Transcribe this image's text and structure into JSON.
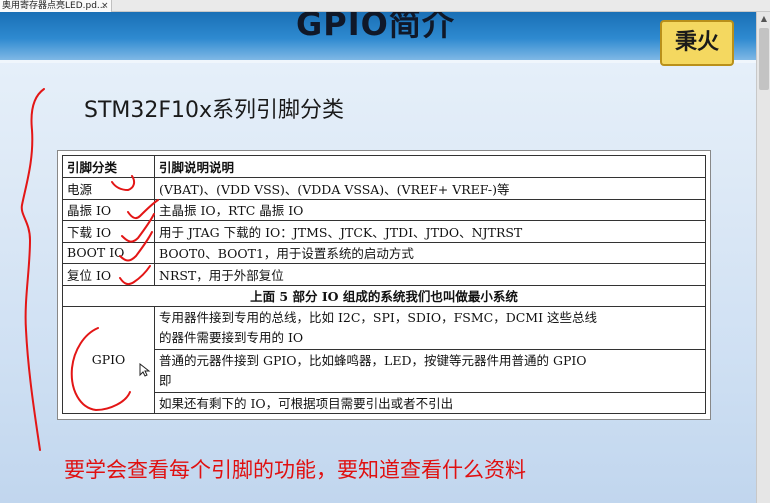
{
  "tab": {
    "title": "奥用寄存器点亮LED.pd...",
    "close": "×"
  },
  "slide": {
    "title": "GPIO简介",
    "logo": "秉火",
    "subtitle": "STM32F10x系列引脚分类",
    "bottom_note": "要学会查看每个引脚的功能，要知道查看什么资料"
  },
  "table": {
    "headers": [
      "引脚分类",
      "引脚说明说明"
    ],
    "rows": [
      [
        "电源",
        "(VBAT)、(VDD VSS)、(VDDA VSSA)、(VREF+ VREF-)等"
      ],
      [
        "晶振 IO",
        "主晶振 IO，RTC 晶振 IO"
      ],
      [
        "下载 IO",
        "用于 JTAG 下载的 IO：JTMS、JTCK、JTDI、JTDO、NJTRST"
      ],
      [
        "BOOT IO",
        "BOOT0、BOOT1，用于设置系统的启动方式"
      ],
      [
        "复位 IO",
        "NRST，用于外部复位"
      ]
    ],
    "merged_row": "上面 5 部分 IO 组成的系统我们也叫做最小系统",
    "gpio_label": "GPIO",
    "gpio_rows": [
      [
        "专用器件接到专用的总线，比如 I2C，SPI，SDIO，FSMC，DCMI 这些总线",
        "的器件需要接到专用的 IO"
      ],
      [
        "普通的元器件接到 GPIO，比如蜂鸣器，LED，按键等元器件用普通的 GPIO",
        "即"
      ],
      [
        "如果还有剩下的 IO，可根据项目需要引出或者不引出"
      ]
    ]
  },
  "colors": {
    "header_blue": "#2e8ad0",
    "note_red": "#e01010",
    "ink_red": "#e31616"
  },
  "icons": {
    "cursor": "mouse-pointer-icon",
    "tab_close": "close-icon"
  }
}
